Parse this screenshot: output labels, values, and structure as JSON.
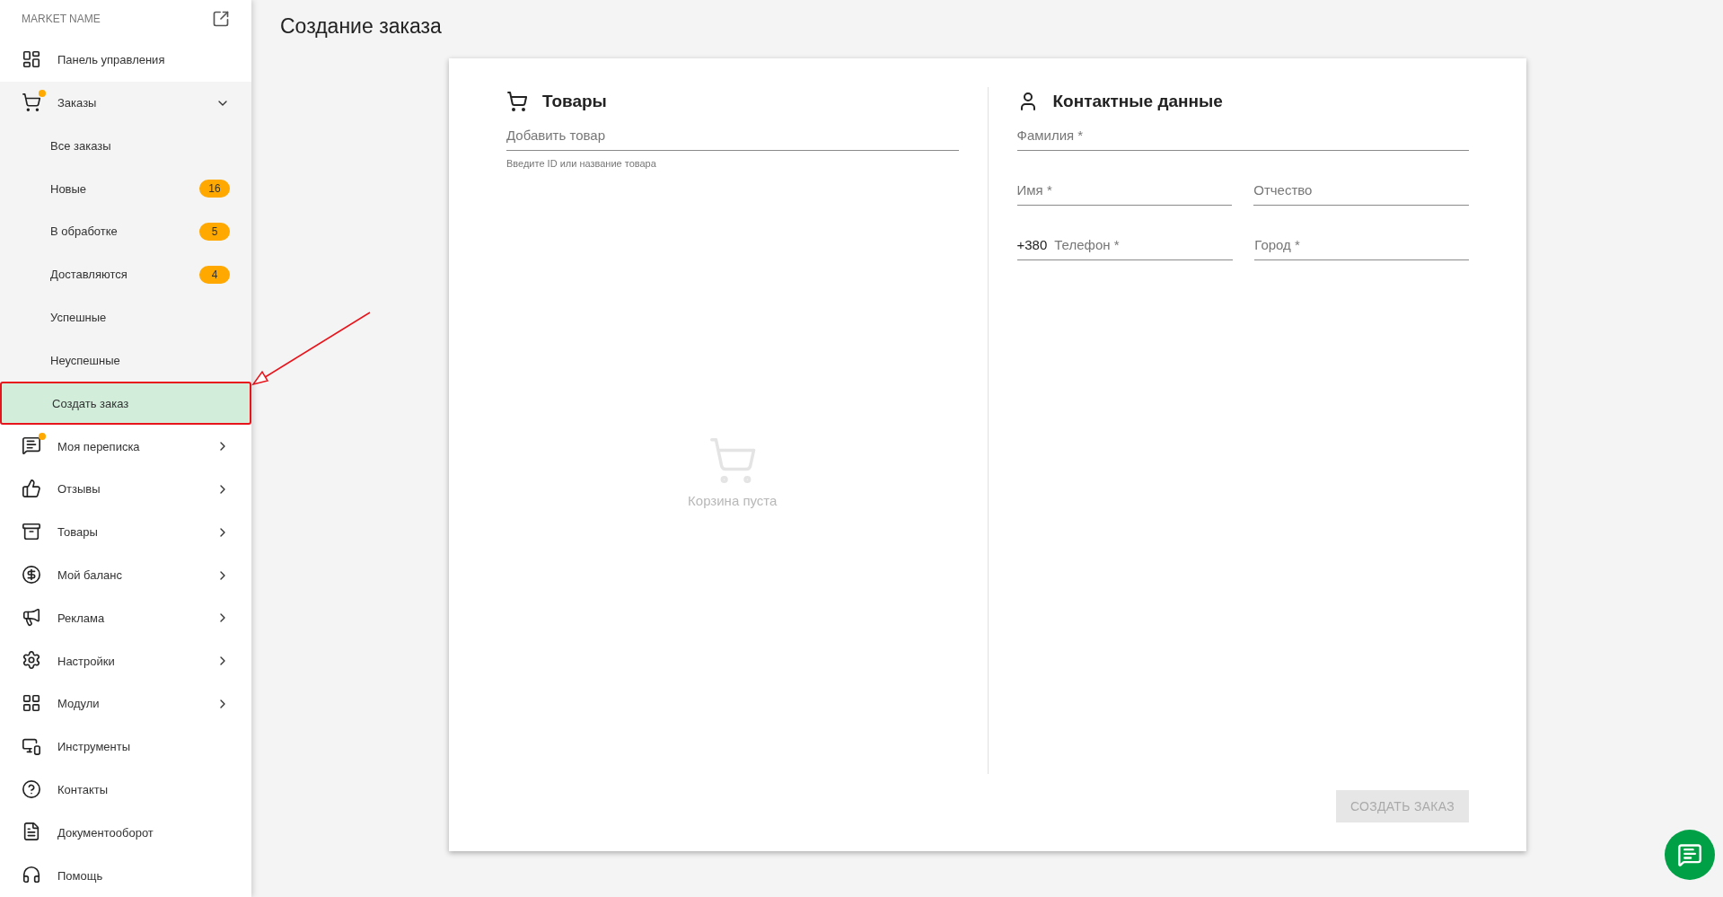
{
  "sidebar": {
    "market_name": "MARKET NAME",
    "items": [
      {
        "label": "Панель управления",
        "dot": false
      },
      {
        "label": "Заказы",
        "dot": true,
        "expanded": true,
        "children": [
          {
            "label": "Все заказы",
            "selected": false
          },
          {
            "label": "Новые",
            "badge": "16",
            "selected": false
          },
          {
            "label": "В обработке",
            "badge": "5",
            "selected": false
          },
          {
            "label": "Доставляются",
            "badge": "4",
            "selected": false
          },
          {
            "label": "Успешные",
            "selected": false
          },
          {
            "label": "Неуспешные",
            "selected": false
          },
          {
            "label": "Создать заказ",
            "selected": true
          }
        ]
      },
      {
        "label": "Моя переписка",
        "dot": true,
        "expanded": false
      },
      {
        "label": "Отзывы",
        "dot": false,
        "expanded": false
      },
      {
        "label": "Товары",
        "dot": false,
        "expanded": false
      },
      {
        "label": "Мой баланс",
        "dot": false,
        "expanded": false
      },
      {
        "label": "Реклама",
        "dot": false,
        "expanded": false
      },
      {
        "label": "Настройки",
        "dot": false,
        "expanded": false
      },
      {
        "label": "Модули",
        "dot": false,
        "expanded": false
      },
      {
        "label": "Инструменты",
        "dot": false
      },
      {
        "label": "Контакты",
        "dot": false
      },
      {
        "label": "Документооборот",
        "dot": false
      },
      {
        "label": "Помощь",
        "dot": false
      }
    ]
  },
  "page": {
    "title": "Создание заказа"
  },
  "products": {
    "heading": "Товары",
    "search": {
      "placeholder": "Добавить товар",
      "helper": "Введите ID или название товара"
    },
    "empty_text": "Корзина пуста"
  },
  "contact": {
    "heading": "Контактные данные",
    "rows": [
      [
        {
          "placeholder": "Фамилия *"
        }
      ],
      [
        {
          "placeholder": "Имя *"
        },
        {
          "placeholder": "Отчество"
        }
      ],
      [
        {
          "prefix": "+380",
          "placeholder": "Телефон *"
        },
        {
          "placeholder": "Город *"
        }
      ]
    ]
  },
  "submit": {
    "label": "СОЗДАТЬ ЗАКАЗ",
    "disabled": true
  }
}
